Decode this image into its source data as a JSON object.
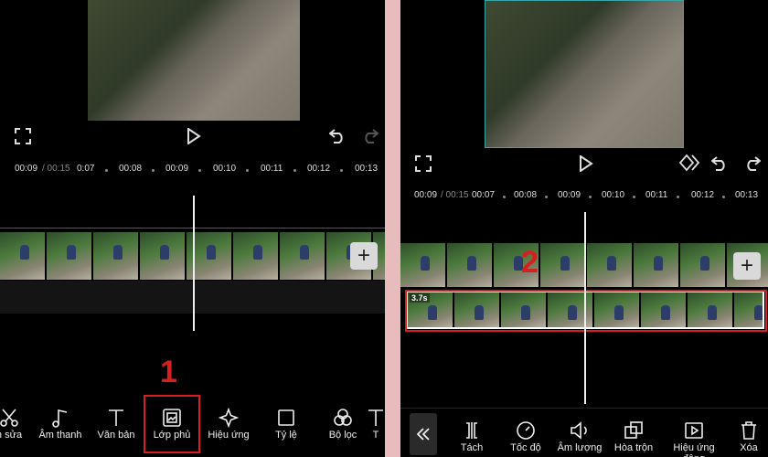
{
  "left": {
    "ruler": {
      "current": "00:09",
      "total": "/ 00:15",
      "ticks": [
        "0:07",
        "00:08",
        "00:09",
        "00:10",
        "00:11",
        "00:12",
        "00:13"
      ]
    },
    "toolbar": [
      {
        "label": "h sửa",
        "icon": "scissors-icon"
      },
      {
        "label": "Âm thanh",
        "icon": "music-note-icon"
      },
      {
        "label": "Văn bản",
        "icon": "text-icon"
      },
      {
        "label": "Lớp phủ",
        "icon": "overlay-icon"
      },
      {
        "label": "Hiệu ứng",
        "icon": "sparkle-icon"
      },
      {
        "label": "Tỷ lệ",
        "icon": "ratio-icon"
      },
      {
        "label": "Bộ lọc",
        "icon": "filter-icon"
      },
      {
        "label": "T",
        "icon": "text-icon"
      }
    ],
    "annotation_number": "1"
  },
  "right": {
    "ruler": {
      "current": "00:09",
      "total": "/ 00:15",
      "ticks": [
        "00:07",
        "00:08",
        "00:09",
        "00:10",
        "00:11",
        "00:12",
        "00:13"
      ]
    },
    "overlay_duration": "3.7s",
    "toolbar": [
      {
        "label": "Tách",
        "icon": "split-icon"
      },
      {
        "label": "Tốc độ",
        "icon": "speed-icon"
      },
      {
        "label": "Âm lượng",
        "icon": "volume-icon"
      },
      {
        "label": "Hòa trộn",
        "icon": "blend-icon"
      },
      {
        "label": "Hiệu ứng động",
        "icon": "animation-icon"
      },
      {
        "label": "Xóa",
        "icon": "delete-icon"
      }
    ],
    "annotation_number": "2"
  },
  "colors": {
    "highlight": "#d81e1e",
    "background": "#000000",
    "overlay_frame": "#37a6a6"
  }
}
